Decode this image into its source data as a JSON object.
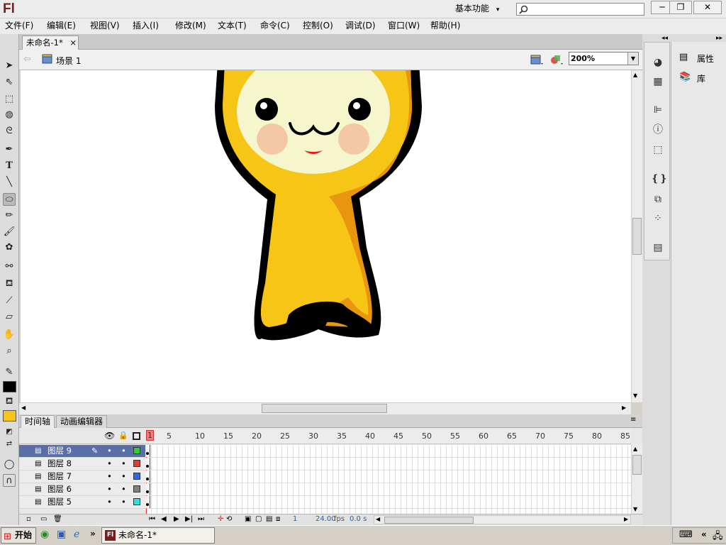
{
  "app": {
    "logo": "Fl",
    "workspace": "基本功能",
    "workspace_chevron": "▾",
    "search_placeholder": ""
  },
  "window_controls": {
    "minimize": "─",
    "restore": "❐",
    "close": "✕"
  },
  "menu": [
    {
      "label": "文件(F)"
    },
    {
      "label": "编辑(E)"
    },
    {
      "label": "视图(V)"
    },
    {
      "label": "插入(I)"
    },
    {
      "label": "修改(M)"
    },
    {
      "label": "文本(T)"
    },
    {
      "label": "命令(C)"
    },
    {
      "label": "控制(O)"
    },
    {
      "label": "调试(D)"
    },
    {
      "label": "窗口(W)"
    },
    {
      "label": "帮助(H)"
    }
  ],
  "document": {
    "tab_title": "未命名-1*",
    "tab_close": "×",
    "scene": "场景 1",
    "zoom": "200%"
  },
  "tools": [
    "selection-tool",
    "subselection-tool",
    "free-transform-tool",
    "3d-rotation-tool",
    "lasso-tool",
    "pen-tool",
    "text-tool",
    "line-tool",
    "oval-tool",
    "pencil-tool",
    "brush-tool",
    "deco-tool",
    "bone-tool",
    "paint-bucket-tool",
    "eyedropper-tool",
    "eraser-tool",
    "hand-tool",
    "zoom-tool"
  ],
  "tool_colors": {
    "stroke": "#000000",
    "fill": "#f7c516"
  },
  "timeline": {
    "tabs": [
      "时间轴",
      "动画编辑器"
    ],
    "ruler": [
      "1",
      "5",
      "10",
      "15",
      "20",
      "25",
      "30",
      "35",
      "40",
      "45",
      "50",
      "55",
      "60",
      "65",
      "70",
      "75",
      "80",
      "85"
    ],
    "layers": [
      {
        "name": "图层 9",
        "color": "#33cc33",
        "selected": true
      },
      {
        "name": "图层 8",
        "color": "#ee3333",
        "selected": false
      },
      {
        "name": "图层 7",
        "color": "#3366ee",
        "selected": false
      },
      {
        "name": "图层 6",
        "color": "#808080",
        "selected": false
      },
      {
        "name": "图层 5",
        "color": "#33dddd",
        "selected": false
      }
    ],
    "footer": {
      "current_frame": "1",
      "fps_value": "24.00",
      "fps_unit": "fps",
      "elapsed": "0.0 s"
    }
  },
  "panels": {
    "properties": "属性",
    "library": "库"
  },
  "taskbar": {
    "start": "开始",
    "task": "未命名-1*",
    "chevron": "»",
    "tray_chevron": "«"
  },
  "character_colors": {
    "body": "#f7c516",
    "body_shade": "#e8960f",
    "outline": "#000000",
    "face": "#f5f6cc",
    "cheek": "#f4c8a4",
    "mouth": "#e81818"
  }
}
